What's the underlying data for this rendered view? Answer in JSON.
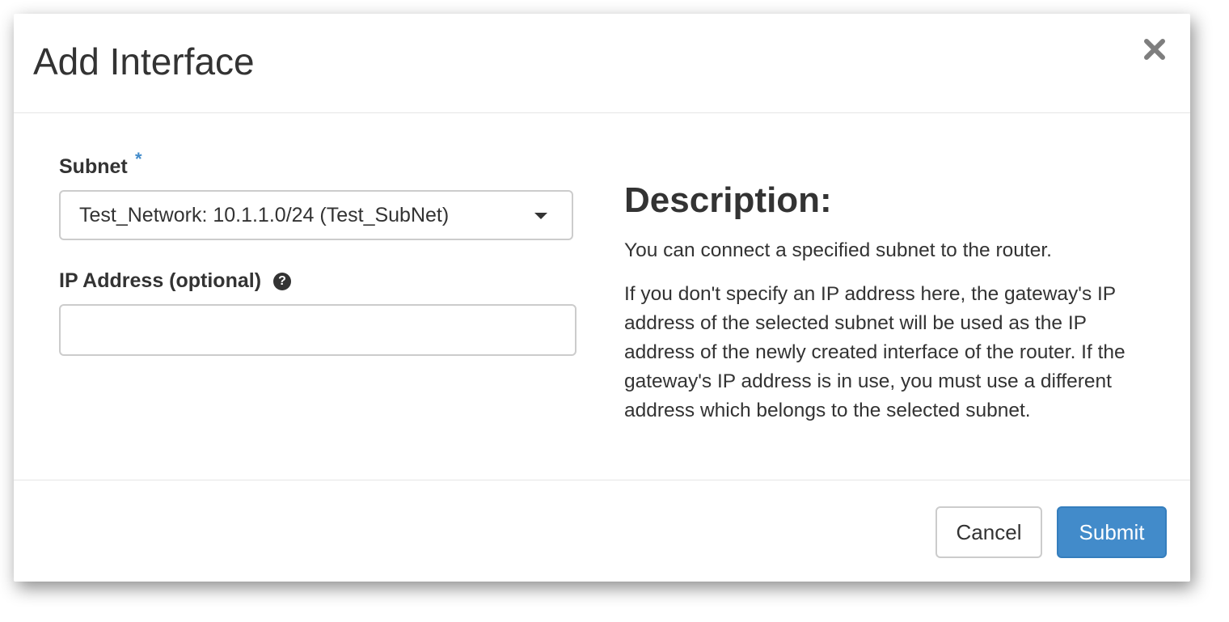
{
  "dialog": {
    "title": "Add Interface",
    "close_icon": "close-icon"
  },
  "form": {
    "subnet": {
      "label": "Subnet",
      "required_marker": "*",
      "selected_value": "Test_Network: 10.1.1.0/24 (Test_SubNet)",
      "caret_icon": "chevron-down-icon"
    },
    "ip_address": {
      "label": "IP Address (optional)",
      "help_icon": "question-circle-icon",
      "help_glyph": "?",
      "value": "",
      "placeholder": ""
    }
  },
  "description": {
    "heading": "Description:",
    "paragraph_1": "You can connect a specified subnet to the router.",
    "paragraph_2": "If you don't specify an IP address here, the gateway's IP address of the selected subnet will be used as the IP address of the newly created interface of the router. If the gateway's IP address is in use, you must use a different address which belongs to the selected subnet."
  },
  "footer": {
    "cancel_label": "Cancel",
    "submit_label": "Submit"
  },
  "colors": {
    "primary": "#428bca",
    "text": "#333333",
    "border": "#cccccc"
  }
}
